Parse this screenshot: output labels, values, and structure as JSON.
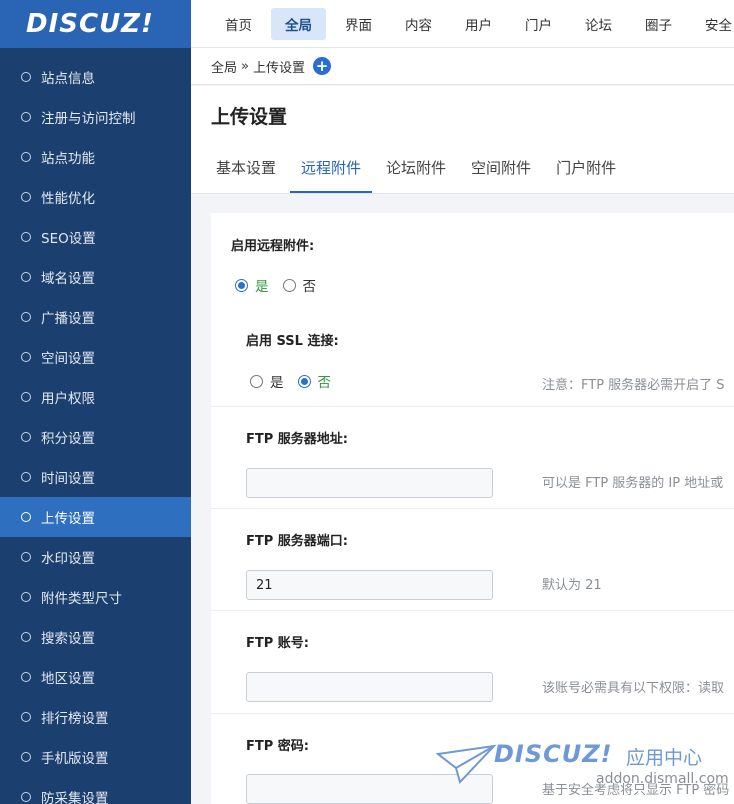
{
  "logo": {
    "text": "DISCUZ",
    "suffix": "!"
  },
  "sidebar": {
    "items": [
      {
        "label": "站点信息"
      },
      {
        "label": "注册与访问控制"
      },
      {
        "label": "站点功能"
      },
      {
        "label": "性能优化"
      },
      {
        "label": "SEO设置"
      },
      {
        "label": "域名设置"
      },
      {
        "label": "广播设置"
      },
      {
        "label": "空间设置"
      },
      {
        "label": "用户权限"
      },
      {
        "label": "积分设置"
      },
      {
        "label": "时间设置"
      },
      {
        "label": "上传设置"
      },
      {
        "label": "水印设置"
      },
      {
        "label": "附件类型尺寸"
      },
      {
        "label": "搜索设置"
      },
      {
        "label": "地区设置"
      },
      {
        "label": "排行榜设置"
      },
      {
        "label": "手机版设置"
      },
      {
        "label": "防采集设置"
      }
    ],
    "active_index": 11
  },
  "topnav": {
    "items": [
      "首页",
      "全局",
      "界面",
      "内容",
      "用户",
      "门户",
      "论坛",
      "圈子",
      "安全"
    ],
    "active_index": 1
  },
  "breadcrumb": {
    "root": "全局",
    "sep": "»",
    "current": "上传设置",
    "add_icon": "plus-circle-icon"
  },
  "page": {
    "title": "上传设置",
    "tabs": [
      "基本设置",
      "远程附件",
      "论坛附件",
      "空间附件",
      "门户附件"
    ],
    "active_tab": 1
  },
  "form": {
    "remote_enable": {
      "label": "启用远程附件:",
      "yes": "是",
      "no": "否",
      "selected": "yes"
    },
    "ssl": {
      "label": "启用 SSL 连接:",
      "yes": "是",
      "no": "否",
      "selected": "no",
      "hint": "注意：FTP 服务器必需开启了 S"
    },
    "ftp_host": {
      "label": "FTP 服务器地址:",
      "value": "",
      "hint": "可以是 FTP 服务器的 IP 地址或"
    },
    "ftp_port": {
      "label": "FTP 服务器端口:",
      "value": "21",
      "hint": "默认为 21"
    },
    "ftp_user": {
      "label": "FTP 账号:",
      "value": "",
      "hint": "该账号必需具有以下权限：读取"
    },
    "ftp_pass": {
      "label": "FTP 密码:",
      "value": "",
      "hint": "基于安全考虑将只显示 FTP 密码"
    }
  },
  "watermark": {
    "logo": "DISCUZ!",
    "sub": "应用中心",
    "url": "addon.dismall.com"
  }
}
